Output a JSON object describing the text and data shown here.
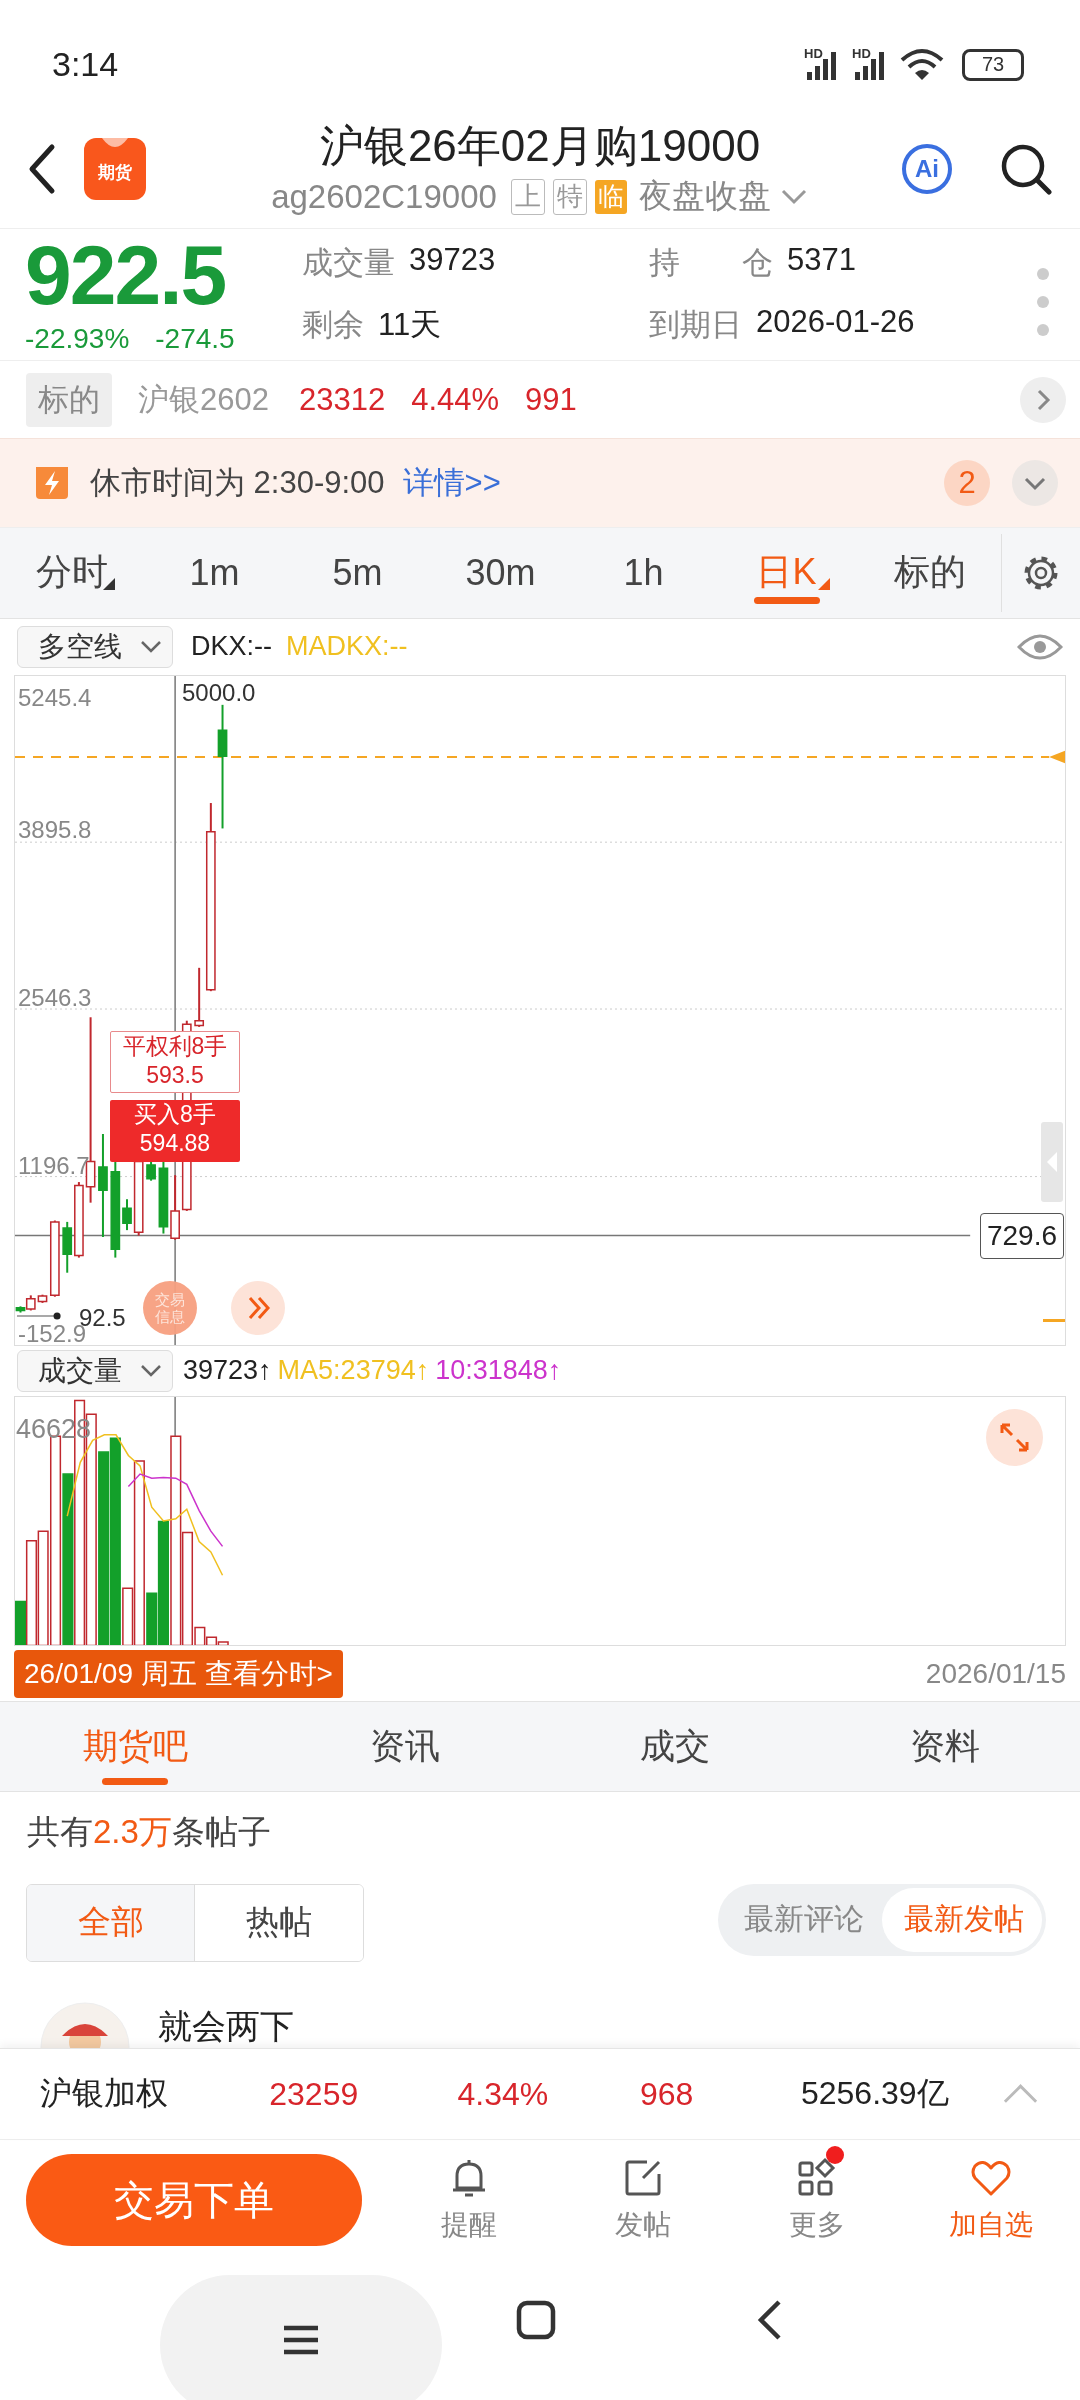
{
  "status_bar": {
    "time": "3:14",
    "networks": [
      {
        "label": "HD"
      },
      {
        "label": "HD"
      }
    ],
    "battery": "73"
  },
  "header": {
    "logo_text": "期货",
    "title": "沪银26年02月购19000",
    "code": "ag2602C19000",
    "tags": [
      {
        "label": "上",
        "kind": "outline"
      },
      {
        "label": "特",
        "kind": "outline"
      },
      {
        "label": "临",
        "kind": "filled"
      }
    ],
    "session": "夜盘收盘",
    "ai_label": "Ai"
  },
  "quote": {
    "price": "922.5",
    "change_pct": "-22.93%",
    "change": "-274.5",
    "stats": [
      {
        "label": "成交量",
        "value": "39723"
      },
      {
        "label": "持　　仓",
        "value": "5371"
      },
      {
        "label": "剩余",
        "value": "11天"
      },
      {
        "label": "到期日",
        "value": "2026-01-26"
      }
    ]
  },
  "underlying": {
    "label": "标的",
    "name": "沪银2602",
    "price": "23312",
    "pct": "4.44%",
    "change": "991"
  },
  "notice": {
    "text": "休市时间为 2:30-9:00",
    "link": "详情>>",
    "badge": "2"
  },
  "periods": [
    {
      "label": "分时",
      "selected": false,
      "menu": true
    },
    {
      "label": "1m",
      "selected": false,
      "menu": false
    },
    {
      "label": "5m",
      "selected": false,
      "menu": false
    },
    {
      "label": "30m",
      "selected": false,
      "menu": false
    },
    {
      "label": "1h",
      "selected": false,
      "menu": false
    },
    {
      "label": "日K",
      "selected": true,
      "menu": true
    },
    {
      "label": "标的",
      "selected": false,
      "menu": false
    }
  ],
  "indicator": {
    "selector": "多空线",
    "values": [
      {
        "text": "DKX:--",
        "color": "#222222"
      },
      {
        "text": "MADKX:--",
        "color": "#f0c020"
      }
    ]
  },
  "kline": {
    "axis_labels": [
      "5245.4",
      "3895.8",
      "2546.3",
      "1196.7",
      "-152.9"
    ],
    "high_label": "5000.0",
    "last_price": "729.6",
    "close_marker": "92.5",
    "trade_badge": "交易信息",
    "trades": [
      {
        "kind": "sell",
        "action": "平权利8手",
        "price": "593.5"
      },
      {
        "kind": "buy",
        "action": "买入8手",
        "price": "594.88"
      }
    ]
  },
  "volume": {
    "selector": "成交量",
    "values": [
      {
        "text": "39723↑",
        "color": "#222222"
      },
      {
        "text": "MA5:23794↑",
        "color": "#f0c020"
      },
      {
        "text": "10:31848↑",
        "color": "#cc33cc"
      }
    ],
    "axis_label": "46628"
  },
  "date_bar": {
    "cursor": "26/01/09 周五 查看分时>",
    "end": "2026/01/15"
  },
  "section_tabs": [
    {
      "label": "期货吧",
      "selected": true
    },
    {
      "label": "资讯",
      "selected": false
    },
    {
      "label": "成交",
      "selected": false
    },
    {
      "label": "资料",
      "selected": false
    }
  ],
  "posts": {
    "count": {
      "before": "共有",
      "highlight": "2.3万",
      "after": "条帖子"
    },
    "filters": [
      {
        "label": "全部",
        "selected": true
      },
      {
        "label": "热帖",
        "selected": false
      }
    ],
    "sort": [
      {
        "label": "最新评论",
        "selected": false
      },
      {
        "label": "最新发帖",
        "selected": true
      }
    ],
    "first_author": "就会两下"
  },
  "summary": {
    "name": "沪银加权",
    "price": "23259",
    "pct": "4.34%",
    "change": "968",
    "amount": "5256.39亿"
  },
  "actions": {
    "primary": "交易下单",
    "items": [
      {
        "label": "提醒",
        "kind": "bell",
        "badge": false
      },
      {
        "label": "发帖",
        "kind": "edit",
        "badge": false
      },
      {
        "label": "更多",
        "kind": "grid",
        "badge": true
      },
      {
        "label": "加自选",
        "kind": "heart",
        "badge": false
      }
    ]
  }
}
